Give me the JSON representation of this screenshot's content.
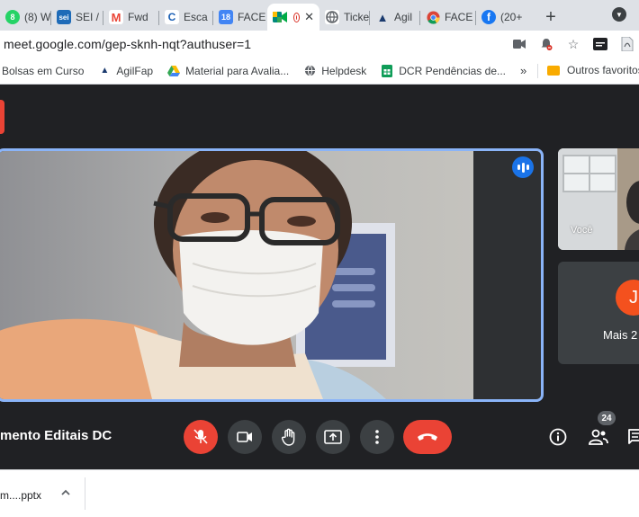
{
  "tabs": [
    {
      "label": "(8) W",
      "favicon": "whatsapp-icon",
      "favicon_text": "8",
      "color": "#25d366"
    },
    {
      "label": "SEI /",
      "favicon": "sei-icon",
      "favicon_text": "sei",
      "color": "#1e6bb8"
    },
    {
      "label": "Fwd",
      "favicon": "gmail-icon",
      "favicon_text": "M",
      "color": "#ea4335"
    },
    {
      "label": "Esca",
      "favicon": "carrefour-icon",
      "favicon_text": "C",
      "color": "#1a5fb4"
    },
    {
      "label": "FACE",
      "favicon": "calendar-icon",
      "favicon_text": "18",
      "color": "#4285f4"
    },
    {
      "label": "",
      "favicon": "meet-icon",
      "favicon_text": "",
      "color": "#00897b",
      "active": true
    },
    {
      "label": "Ticke",
      "favicon": "globe-icon",
      "favicon_text": "",
      "color": "#5f6368"
    },
    {
      "label": "Agil",
      "favicon": "agilfap-icon",
      "favicon_text": "A",
      "color": "#1a3a6e"
    },
    {
      "label": "FACE",
      "favicon": "chrome-icon",
      "favicon_text": "",
      "color": "#fbbc04"
    },
    {
      "label": "(20+",
      "favicon": "facebook-icon",
      "favicon_text": "f",
      "color": "#1877f2"
    }
  ],
  "address": {
    "url": "meet.google.com/gep-sknh-nqt?authuser=1"
  },
  "bookmarks": [
    {
      "label": "Bolsas em Curso",
      "icon": "none"
    },
    {
      "label": "AgilFap",
      "icon": "agilfap-icon"
    },
    {
      "label": "Material para Avalia...",
      "icon": "drive-icon"
    },
    {
      "label": "Helpdesk",
      "icon": "globe-icon"
    },
    {
      "label": "DCR Pendências de...",
      "icon": "sheets-icon"
    }
  ],
  "bookmarks_more": "»",
  "bookmarks_other": "Outros favoritos",
  "meet": {
    "meeting_title": "mento Editais DC",
    "self_label": "Você",
    "more_tile": {
      "avatar_letter": "J",
      "label": "Mais 2"
    },
    "participants_count": "24",
    "accent_color": "#8ab4f8",
    "hangup_color": "#ea4335"
  },
  "downloads": {
    "file_name": "m....pptx"
  }
}
